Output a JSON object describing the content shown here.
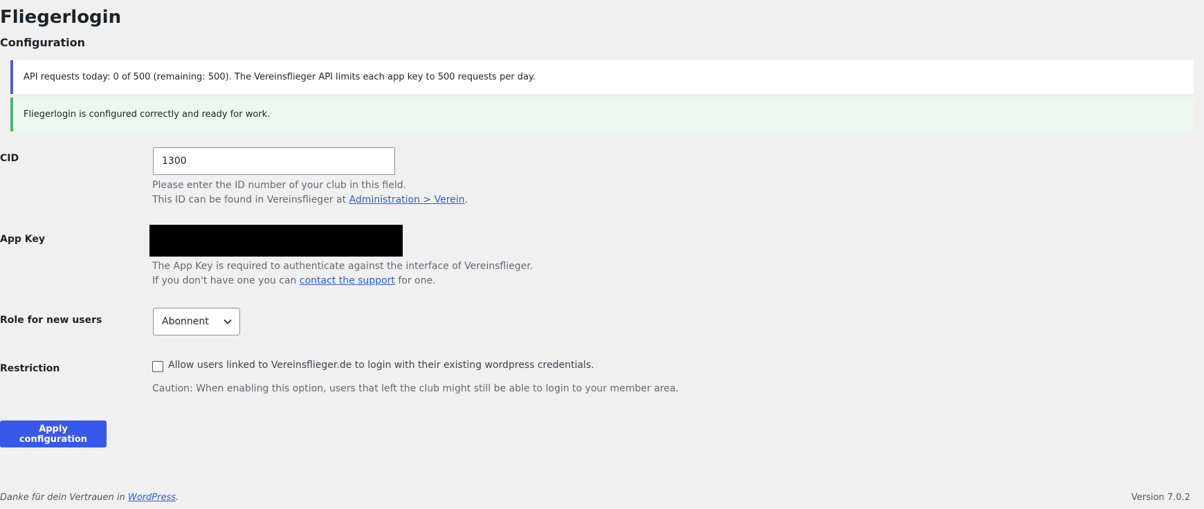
{
  "header": {
    "title": "Fliegerlogin",
    "subtitle": "Configuration"
  },
  "notices": {
    "info": "API requests today: 0 of 500 (remaining: 500). The Vereinsflieger API limits each app key to 500 requests per day.",
    "success": "Fliegerlogin is configured correctly and ready for work."
  },
  "fields": {
    "cid": {
      "label": "CID",
      "value": "1300",
      "desc_line1": "Please enter the ID number of your club in this field.",
      "desc_line2_prefix": "This ID can be found in Vereinsflieger at ",
      "desc_line2_link": "Administration > Verein",
      "desc_line2_suffix": "."
    },
    "app_key": {
      "label": "App Key",
      "desc_line1": "The App Key is required to authenticate against the interface of Vereinsflieger.",
      "desc_line2_prefix": "If you don't have one you can ",
      "desc_line2_link": "contact the support",
      "desc_line2_suffix": " for one."
    },
    "role": {
      "label": "Role for new users",
      "selected": "Abonnent"
    },
    "restriction": {
      "label": "Restriction",
      "checkbox_label": "Allow users linked to Vereinsflieger.de to login with their existing wordpress credentials.",
      "checked": false,
      "caution": "Caution: When enabling this option, users that left the club might still be able to login to your member area."
    }
  },
  "actions": {
    "apply_label": "Apply configuration"
  },
  "footer": {
    "thanks_prefix": "Danke für dein Vertrauen in ",
    "thanks_link": "WordPress",
    "thanks_suffix": ".",
    "version": "Version 7.0.2"
  },
  "colors": {
    "primary_button": "#3858e9",
    "info_border": "#4f5bd5",
    "success_border": "#4ab866",
    "success_bg": "#edf7ef",
    "link": "#2f5bd6",
    "background": "#f0f0f1"
  },
  "icons": {
    "select_chevron": "chevron-down-icon"
  }
}
